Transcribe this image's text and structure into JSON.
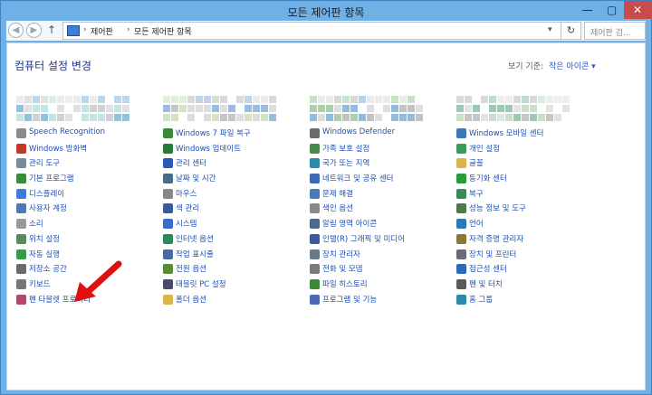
{
  "window": {
    "title": "모든 제어판 항목",
    "min": "—",
    "max": "▢",
    "close": "✕"
  },
  "address": {
    "back": "◀",
    "forward": "▶",
    "up": "↑",
    "crumbs": [
      "제어판",
      "모든 제어판 항목"
    ],
    "separator": "›",
    "dropdown": "▾",
    "refresh": "↻",
    "search_placeholder": "제어판 검..."
  },
  "content": {
    "heading": "컴퓨터 설정 변경",
    "view_by_label": "보기 기준:",
    "view_by_value": "작은 아이콘 ▾"
  },
  "columns": [
    [
      {
        "label": "Speech Recognition",
        "icon": "microphone-icon",
        "color": "#8a8a8a"
      },
      {
        "label": "Windows 방화벽",
        "icon": "firewall-icon",
        "color": "#c0392b"
      },
      {
        "label": "관리 도구",
        "icon": "admin-tools-icon",
        "color": "#7a8a9a"
      },
      {
        "label": "기본 프로그램",
        "icon": "default-programs-icon",
        "color": "#3a8a3a"
      },
      {
        "label": "디스플레이",
        "icon": "display-icon",
        "color": "#3b7dd8"
      },
      {
        "label": "사용자 계정",
        "icon": "user-accounts-icon",
        "color": "#4a7ab8"
      },
      {
        "label": "소리",
        "icon": "sound-icon",
        "color": "#999999"
      },
      {
        "label": "위치 설정",
        "icon": "location-icon",
        "color": "#5a8a5a"
      },
      {
        "label": "자동 실행",
        "icon": "autoplay-icon",
        "color": "#3a9a4a"
      },
      {
        "label": "저장소 공간",
        "icon": "storage-icon",
        "color": "#6a6a6a"
      },
      {
        "label": "키보드",
        "icon": "keyboard-icon",
        "color": "#777777"
      },
      {
        "label": "펜 타블렛 프로퍼티",
        "icon": "pen-tablet-icon",
        "color": "#b04a6a"
      }
    ],
    [
      {
        "label": "Windows 7 파일 복구",
        "icon": "file-recovery-icon",
        "color": "#3a8a3a"
      },
      {
        "label": "Windows 업데이트",
        "icon": "windows-update-icon",
        "color": "#2a7a3a"
      },
      {
        "label": "관리 센터",
        "icon": "flag-icon",
        "color": "#2a5ab8"
      },
      {
        "label": "날짜 및 시간",
        "icon": "clock-icon",
        "color": "#4a6a8a"
      },
      {
        "label": "마우스",
        "icon": "mouse-icon",
        "color": "#888888"
      },
      {
        "label": "색 관리",
        "icon": "color-mgmt-icon",
        "color": "#3a5a9a"
      },
      {
        "label": "시스템",
        "icon": "system-icon",
        "color": "#3b6dc8"
      },
      {
        "label": "인터넷 옵션",
        "icon": "internet-icon",
        "color": "#2a8a5a"
      },
      {
        "label": "작업 표시줄",
        "icon": "taskbar-icon",
        "color": "#4a6a9a"
      },
      {
        "label": "전원 옵션",
        "icon": "power-icon",
        "color": "#5a8a3a"
      },
      {
        "label": "태블릿 PC 설정",
        "icon": "tablet-icon",
        "color": "#4a4a6a"
      },
      {
        "label": "폴더 옵션",
        "icon": "folder-icon",
        "color": "#d8b44a"
      }
    ],
    [
      {
        "label": "Windows Defender",
        "icon": "defender-icon",
        "color": "#6a6a6a"
      },
      {
        "label": "가족 보호 설정",
        "icon": "family-icon",
        "color": "#4a8a4a"
      },
      {
        "label": "국가 또는 지역",
        "icon": "globe-icon",
        "color": "#2a8aa8"
      },
      {
        "label": "네트워크 및 공유 센터",
        "icon": "network-icon",
        "color": "#3a6ab8"
      },
      {
        "label": "문제 해결",
        "icon": "troubleshoot-icon",
        "color": "#4a7ab8"
      },
      {
        "label": "색인 옵션",
        "icon": "indexing-icon",
        "color": "#8a8a8a"
      },
      {
        "label": "알림 영역 아이콘",
        "icon": "notification-icon",
        "color": "#4a6a8a"
      },
      {
        "label": "인텔(R) 그래픽 및 미디어",
        "icon": "intel-graphics-icon",
        "color": "#3a5a9a"
      },
      {
        "label": "장치 관리자",
        "icon": "device-manager-icon",
        "color": "#6a7a8a"
      },
      {
        "label": "전화 및 모뎀",
        "icon": "phone-icon",
        "color": "#7a7a7a"
      },
      {
        "label": "파일 히스토리",
        "icon": "file-history-icon",
        "color": "#3a8a3a"
      },
      {
        "label": "프로그램 및 기능",
        "icon": "programs-icon",
        "color": "#4a6ab8"
      }
    ],
    [
      {
        "label": "Windows 모바일 센터",
        "icon": "mobility-icon",
        "color": "#3a7ab8"
      },
      {
        "label": "개인 설정",
        "icon": "personalize-icon",
        "color": "#3a9a5a"
      },
      {
        "label": "글꼴",
        "icon": "fonts-icon",
        "color": "#d8b44a"
      },
      {
        "label": "동기화 센터",
        "icon": "sync-icon",
        "color": "#2a9a3a"
      },
      {
        "label": "복구",
        "icon": "recovery-icon",
        "color": "#3a8a5a"
      },
      {
        "label": "성능 정보 및 도구",
        "icon": "performance-icon",
        "color": "#4a7a4a"
      },
      {
        "label": "언어",
        "icon": "language-icon",
        "color": "#2a7ab8"
      },
      {
        "label": "자격 증명 관리자",
        "icon": "credentials-icon",
        "color": "#8a7a3a"
      },
      {
        "label": "장치 및 프린터",
        "icon": "printer-icon",
        "color": "#6a6a7a"
      },
      {
        "label": "접근성 센터",
        "icon": "accessibility-icon",
        "color": "#2a6ab8"
      },
      {
        "label": "펜 및 터치",
        "icon": "pen-touch-icon",
        "color": "#5a5a5a"
      },
      {
        "label": "홈 그룹",
        "icon": "homegroup-icon",
        "color": "#2a8aa8"
      }
    ]
  ],
  "colors": {
    "accent": "#1d4fb0",
    "heading": "#1e3287",
    "arrow": "#e01010"
  }
}
